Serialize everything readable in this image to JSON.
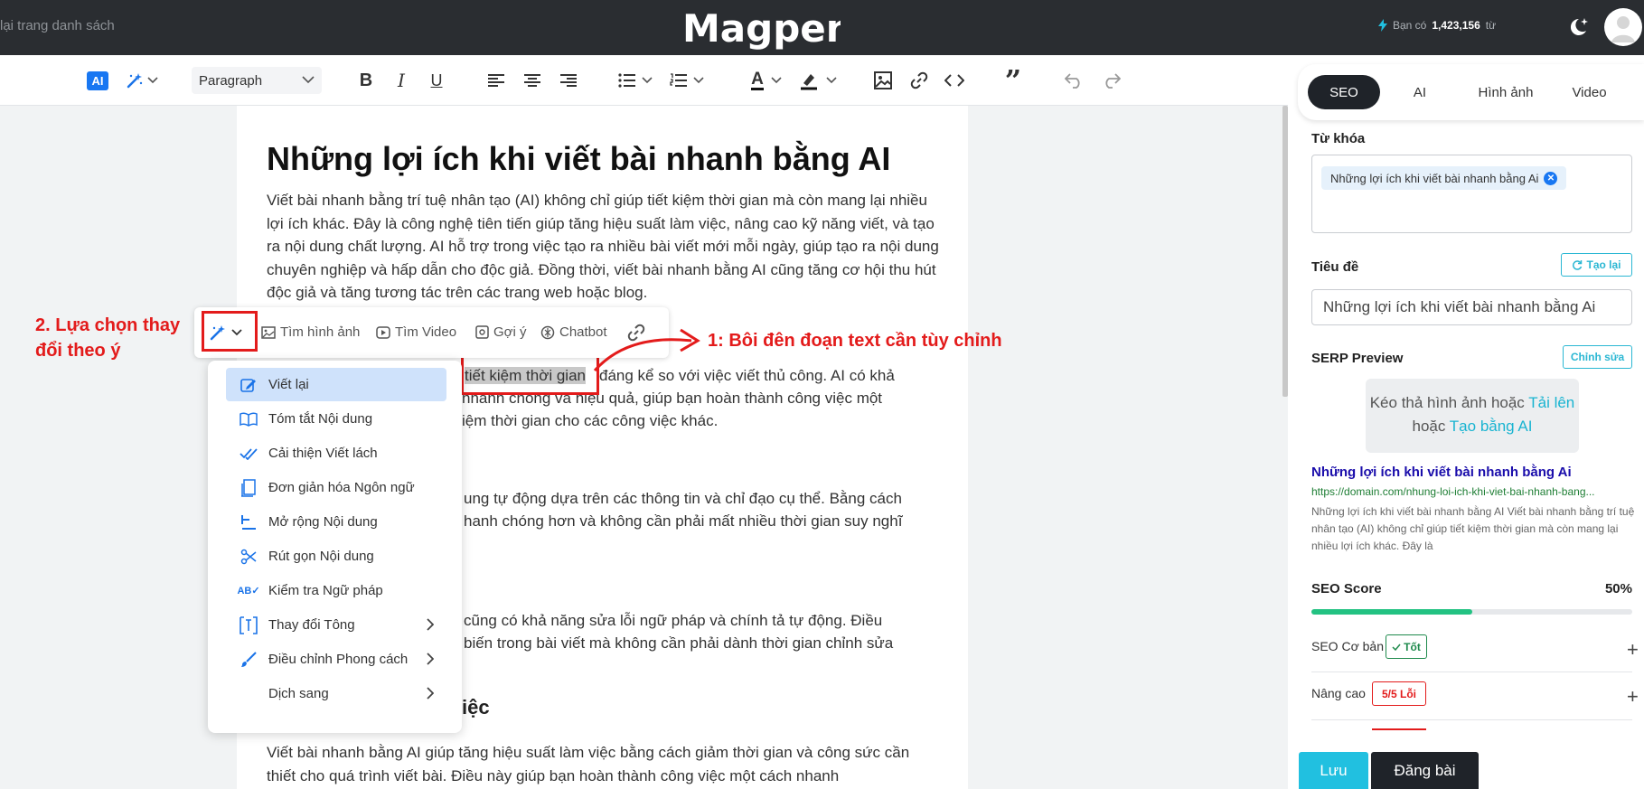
{
  "topbar": {
    "back_label": "lại trang danh sách",
    "logo_text": "Magpen",
    "credits_prefix": "Bạn có",
    "credits_value": "1,423,156",
    "credits_unit": "từ"
  },
  "toolbar": {
    "ai_label": "AI",
    "paragraph_label": "Paragraph",
    "bold_label": "B",
    "italic_label": "I",
    "underline_label": "U",
    "text_color_label": "A",
    "quote_label": "”"
  },
  "document": {
    "title": "Những lợi ích khi viết bài nhanh bằng AI",
    "intro": "Viết bài nhanh bằng trí tuệ nhân tạo (AI) không chỉ giúp tiết kiệm thời gian mà còn mang lại nhiều lợi ích khác. Đây là công nghệ tiên tiến giúp tăng hiệu suất làm việc, nâng cao kỹ năng viết, và tạo ra nội dung chất lượng. AI hỗ trợ trong việc tạo ra nhiều bài viết mới mỗi ngày, giúp tạo ra nội dung chuyên nghiệp và hấp dẫn cho độc giả. Đồng thời, viết bài nhanh bằng AI cũng tăng cơ hội thu hút độc giả và tăng tương tác trên các trang web hoặc blog.",
    "selected_text": "tiết kiệm thời gian",
    "p2_line1_after": "đáng kể so với việc viết thủ công. AI có khả",
    "p2_line2": "nhanh chóng và hiệu quả, giúp bạn hoàn thành công việc một",
    "p2_line3": "iệm thời gian cho các công việc khác.",
    "p3_line1": "ung tự động dựa trên các thông tin và chỉ đạo cụ thể. Bằng cách",
    "p3_line2": "hanh chóng hơn và không cần phải mất nhiều thời gian suy nghĩ",
    "p4_line1": "cũng có khả năng sửa lỗi ngữ pháp và chính tả tự động. Điều",
    "p4_line2": "biến trong bài viết mà không cần phải dành thời gian chỉnh sửa",
    "heading_fragment": "iệc",
    "p5": "Viết bài nhanh bằng AI giúp tăng hiệu suất làm việc bằng cách giảm thời gian và công sức cần thiết cho quá trình viết bài. Điều này giúp bạn hoàn thành công việc một cách nhanh"
  },
  "inline_toolbar": {
    "image_search": "Tìm hình ảnh",
    "video_search": "Tìm Video",
    "suggest": "Gợi ý",
    "chatbot": "Chatbot"
  },
  "ai_menu": {
    "items": [
      {
        "label": "Viết lại",
        "icon": "edit-icon"
      },
      {
        "label": "Tóm tắt Nội dung",
        "icon": "book-icon"
      },
      {
        "label": "Cải thiện Viết lách",
        "icon": "double-check-icon"
      },
      {
        "label": "Đơn giản hóa Ngôn ngữ",
        "icon": "document-icon"
      },
      {
        "label": "Mở rộng Nội dung",
        "icon": "expand-lines-icon"
      },
      {
        "label": "Rút gọn Nội dung",
        "icon": "scissors-icon"
      },
      {
        "label": "Kiểm tra Ngữ pháp",
        "icon": "spellcheck-icon"
      },
      {
        "label": "Thay đổi Tông",
        "icon": "text-frame-icon"
      },
      {
        "label": "Điều chỉnh Phong cách",
        "icon": "brush-icon"
      },
      {
        "label": "Dịch sang",
        "icon": ""
      }
    ]
  },
  "annotations": {
    "step1": "1: Bôi đên đoạn text cần tùy chỉnh",
    "step2_line1": "2. Lựa chọn thay",
    "step2_line2": "đổi theo ý"
  },
  "panel": {
    "tabs": [
      "SEO",
      "AI",
      "Hình ảnh",
      "Video"
    ],
    "keyword_label": "Từ khóa",
    "keyword_chip": "Những lợi ích khi viết bài nhanh bằng Ai",
    "title_label": "Tiêu đề",
    "regenerate_label": "Tạo lại",
    "title_value": "Những lợi ích khi viết bài nhanh bằng Ai",
    "serp_label": "SERP Preview",
    "edit_label": "Chỉnh sửa",
    "drop_text": "Kéo thả hình ảnh hoặc",
    "upload_link": "Tải lên",
    "or_text": "hoặc",
    "generate_link": "Tạo bằng AI",
    "serp_title": "Những lợi ích khi viết bài nhanh bằng Ai",
    "serp_url": "https://domain.com/nhung-loi-ich-khi-viet-bai-nhanh-bang...",
    "serp_desc": "Những lợi ích khi viết bài nhanh bằng AI Viết bài nhanh bằng trí tuệ nhân tạo (AI) không chỉ giúp tiết kiệm thời gian mà còn mang lại nhiều lợi ích khác. Đây là",
    "score_label": "SEO Score",
    "score_value": "50%",
    "score_fraction": 0.5,
    "basic_label": "SEO Cơ bản",
    "basic_badge": "Tốt",
    "advanced_label": "Nâng cao",
    "advanced_badge": "5/5 Lỗi",
    "save_label": "Lưu",
    "publish_label": "Đăng bài"
  },
  "colors": {
    "accent": "#1877f2",
    "cyan": "#21c0e0",
    "annotation_red": "#e31b1b",
    "good_green": "#23c282"
  }
}
